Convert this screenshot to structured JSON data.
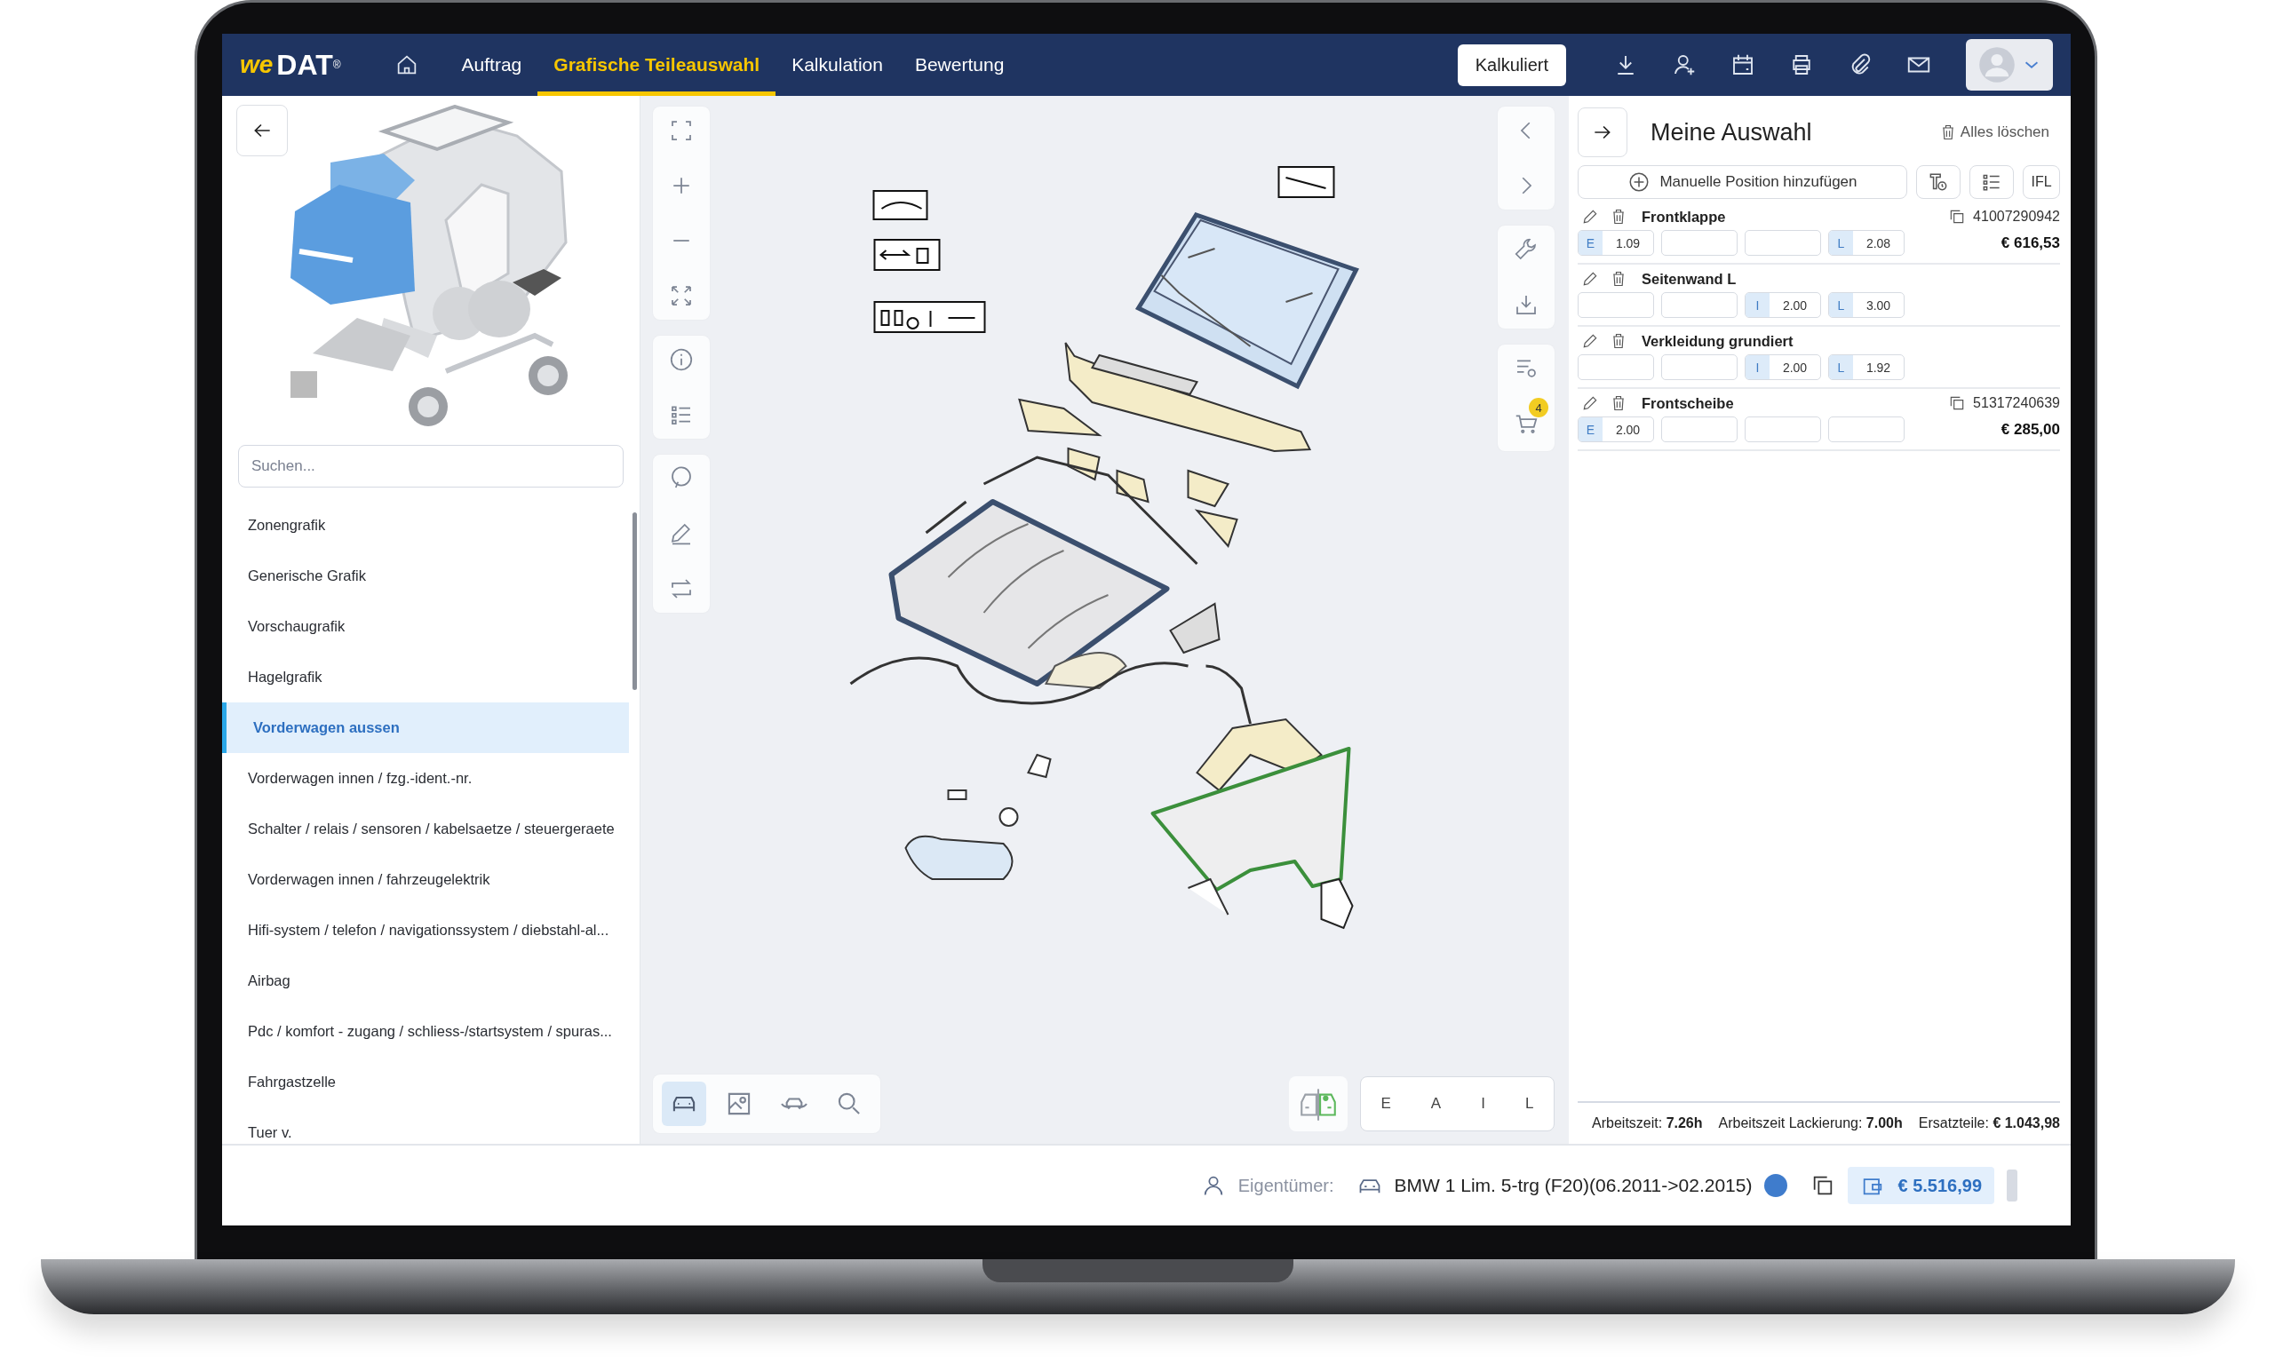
{
  "nav": {
    "logo_prefix": "we",
    "logo": "DAT",
    "logo_mark": "®",
    "tabs": [
      {
        "label": "Auftrag",
        "selected": false
      },
      {
        "label": "Grafische Teileauswahl",
        "selected": true
      },
      {
        "label": "Kalkulation",
        "selected": false
      },
      {
        "label": "Bewertung",
        "selected": false
      }
    ],
    "status_button": "Kalkuliert"
  },
  "left_panel": {
    "search": {
      "placeholder": "Suchen..."
    },
    "items": [
      {
        "label": "Zonengrafik",
        "selected": false
      },
      {
        "label": "Generische Grafik",
        "selected": false
      },
      {
        "label": "Vorschaugrafik",
        "selected": false
      },
      {
        "label": "Hagelgrafik",
        "selected": false
      },
      {
        "label": "Vorderwagen aussen",
        "selected": true
      },
      {
        "label": "Vorderwagen innen / fzg.-ident.-nr.",
        "selected": false
      },
      {
        "label": "Schalter / relais / sensoren / kabelsaetze / steuergeraete",
        "selected": false
      },
      {
        "label": "Vorderwagen innen / fahrzeugelektrik",
        "selected": false
      },
      {
        "label": "Hifi-system / telefon / navigationssystem / diebstahl-al...",
        "selected": false
      },
      {
        "label": "Airbag",
        "selected": false
      },
      {
        "label": "Pdc / komfort - zugang / schliess-/startsystem / spuras...",
        "selected": false
      },
      {
        "label": "Fahrgastzelle",
        "selected": false
      },
      {
        "label": "Tuer v.",
        "selected": false
      }
    ]
  },
  "canvas": {
    "cart_count": "4",
    "view_modes": [
      {
        "selected": true
      },
      {
        "selected": false
      },
      {
        "selected": false
      },
      {
        "selected": false
      }
    ],
    "filters": [
      "E",
      "A",
      "I",
      "L"
    ]
  },
  "selection": {
    "title": "Meine Auswahl",
    "clear_all": "Alles löschen",
    "add_button": "Manuelle Position hinzufügen",
    "ifl_button": "IFL",
    "positions": [
      {
        "name": "Frontklappe",
        "number": "41007290942",
        "price": "€ 616,53",
        "fields": [
          {
            "tag": "E",
            "value": "1.09"
          },
          {
            "empty": true
          },
          {
            "empty": true
          },
          {
            "tag": "L",
            "value": "2.08"
          }
        ]
      },
      {
        "name": "Seitenwand L",
        "fields": [
          {
            "empty": true
          },
          {
            "empty": true
          },
          {
            "tag": "I",
            "value": "2.00"
          },
          {
            "tag": "L",
            "value": "3.00"
          }
        ]
      },
      {
        "name": "Verkleidung grundiert",
        "fields": [
          {
            "empty": true
          },
          {
            "empty": true
          },
          {
            "tag": "I",
            "value": "2.00"
          },
          {
            "tag": "L",
            "value": "1.92"
          }
        ]
      },
      {
        "name": "Frontscheibe",
        "number": "51317240639",
        "price": "€ 285,00",
        "fields": [
          {
            "tag": "E",
            "value": "2.00"
          },
          {
            "empty": true
          },
          {
            "empty": true
          },
          {
            "empty": true
          }
        ]
      }
    ],
    "summary": [
      "Arbeitszeit: **7.26h**",
      "Arbeitszeit Lackierung: **7.00h**",
      "Ersatzteile: **€ 1.043,98**"
    ]
  },
  "footer": {
    "owner_label": "Eigentümer:",
    "vehicle": "BMW 1 Lim. 5-trg (F20)(06.2011->02.2015)",
    "total": "€ 5.516,99"
  }
}
